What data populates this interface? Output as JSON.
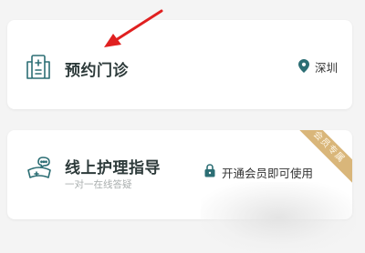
{
  "appointment_card": {
    "title": "预约门诊",
    "location": "深圳",
    "icons": {
      "main": "clinic-icon",
      "location": "location-pin-icon"
    }
  },
  "nursing_card": {
    "title": "线上护理指导",
    "subtitle": "一对一在线答疑",
    "member_note": "开通会员即可使用",
    "ribbon": "会员专属",
    "icons": {
      "main": "nurse-cap-icon",
      "lock": "lock-icon"
    }
  },
  "annotation": {
    "arrow_color": "#e02020"
  },
  "colors": {
    "accent": "#2c6e74",
    "ribbon": "#d9b67a"
  }
}
